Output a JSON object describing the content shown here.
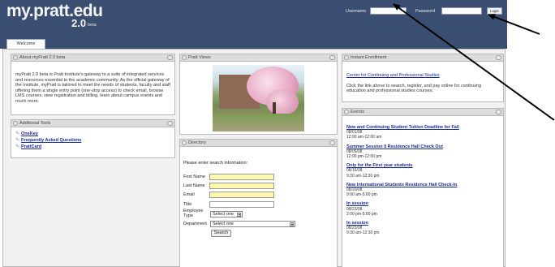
{
  "header": {
    "logo": "my.pratt.edu",
    "version": "2.0",
    "beta": "beta",
    "username_label": "Username",
    "password_label": "Password",
    "login_button": "Login",
    "tab_welcome": "Welcome"
  },
  "about": {
    "title": "About myPratt 2.0 beta",
    "body": "myPratt 2.0 beta is Pratt Institute's gateway to a suite of integrated services and resources essential to the academic community. As the official gateway of the Institute, myPratt is tailored to meet the needs of students, faculty and staff offering them a single entry point (one-stop access) to check email, browse LMS courses, view registration and billing, learn about campus events and much more."
  },
  "tools": {
    "title": "Additional Tools",
    "items": [
      "OneKey",
      "Frequently Asked Questions",
      "PrattCard"
    ]
  },
  "views": {
    "title": "Pratt Views"
  },
  "directory": {
    "title": "Directory",
    "intro": "Please enter search information:",
    "fields": {
      "first": "First Name",
      "last": "Last Name",
      "email": "Email",
      "title": "Title",
      "employee_type": "Employee",
      "employee_type2": "Type",
      "department": "Department"
    },
    "employee_select": "Select one",
    "department_select": "Select one",
    "search_button": "Search"
  },
  "enrollment": {
    "title": "Instant Enrollment",
    "link": "Center for Continuing and Professional Studies",
    "body": "Click the link above to search, register, and pay online for continuing education and professional studies courses."
  },
  "events": {
    "title": "Events",
    "items": [
      {
        "title": "New and Continuing Student Tuition Deadline for Fall",
        "date": "08/01/08",
        "time": "12:00 am-12:00 am"
      },
      {
        "title": "Summer Session II Residence Hall Check Out",
        "date": "08/05/08",
        "time": "12:00 pm-12:00 pm"
      },
      {
        "title": "Only for the First year students",
        "date": "08/16/08",
        "time": "9:30 am-12:30 pm"
      },
      {
        "title": "New International Students Residence Hall Check-In",
        "date": "08/20/08",
        "time": "9:00 am-5:00 pm"
      },
      {
        "title": "In session",
        "date": "08/23/08",
        "time": "2:00 pm-5:00 pm"
      },
      {
        "title": "In session",
        "date": "08/23/08",
        "time": "9:30 am-12:30 pm"
      }
    ]
  },
  "colors": {
    "header_bg": "#3a4e72",
    "link": "#1a2c9c",
    "field_highlight": "#fff9b0"
  }
}
